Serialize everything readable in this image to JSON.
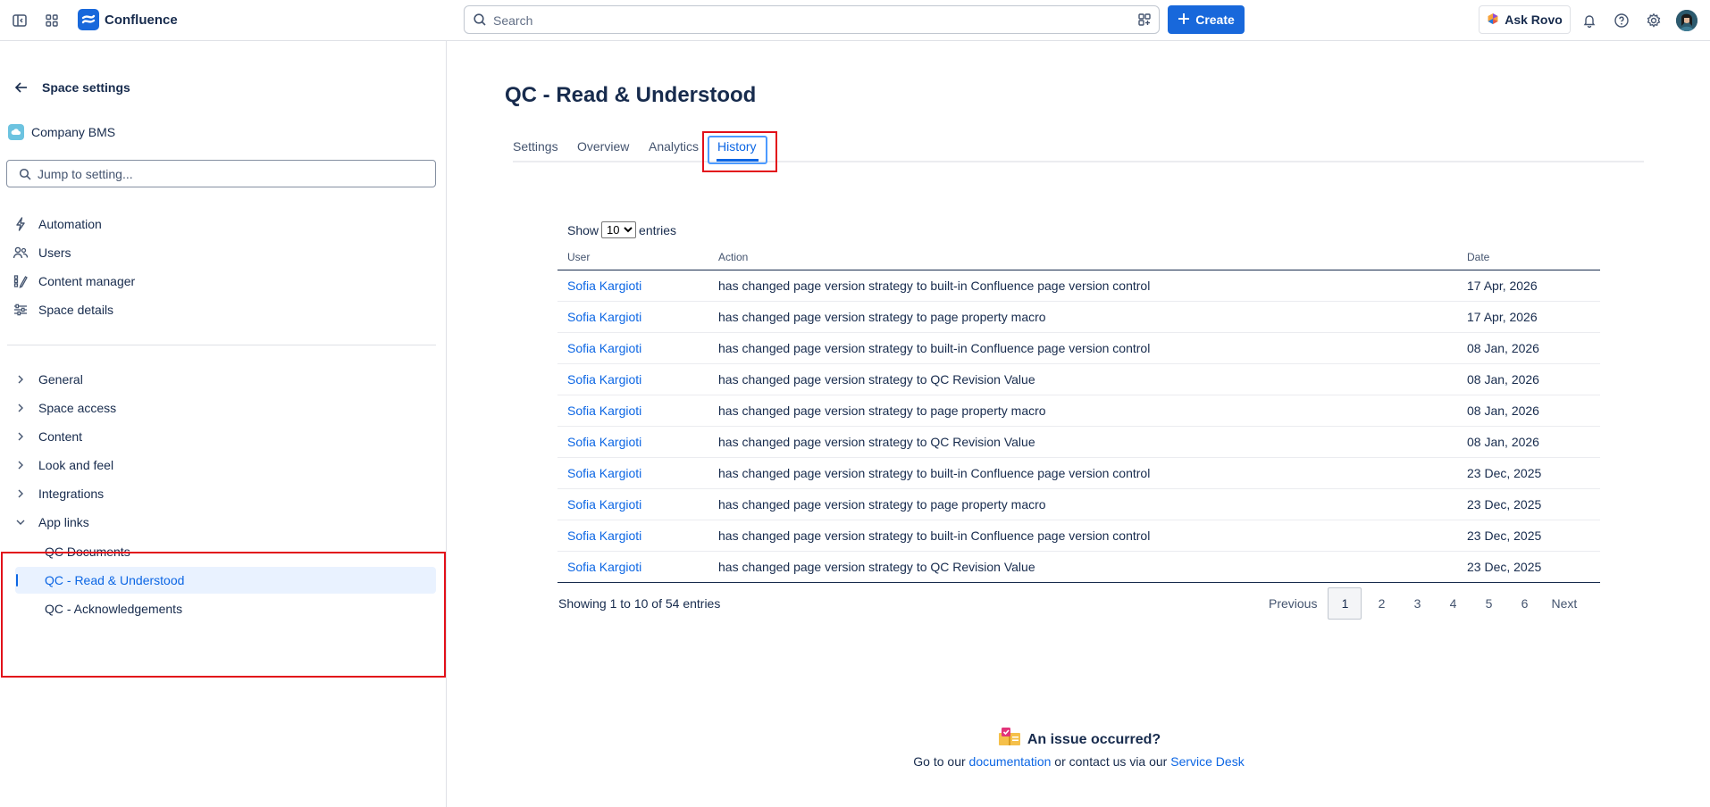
{
  "app": {
    "name": "Confluence"
  },
  "search": {
    "placeholder": "Search"
  },
  "topbar": {
    "create_label": "Create",
    "rovo_label": "Ask Rovo"
  },
  "sidebar": {
    "title": "Space settings",
    "space_name": "Company BMS",
    "jump_placeholder": "Jump to setting...",
    "top_items": [
      {
        "label": "Automation",
        "icon": "lightning-icon"
      },
      {
        "label": "Users",
        "icon": "users-icon"
      },
      {
        "label": "Content manager",
        "icon": "content-manager-icon"
      },
      {
        "label": "Space details",
        "icon": "sliders-icon"
      }
    ],
    "groups": [
      {
        "label": "General"
      },
      {
        "label": "Space access"
      },
      {
        "label": "Content"
      },
      {
        "label": "Look and feel"
      },
      {
        "label": "Integrations"
      },
      {
        "label": "App links"
      }
    ],
    "app_links": [
      {
        "label": "QC Documents"
      },
      {
        "label": "QC - Read & Understood",
        "selected": true
      },
      {
        "label": "QC - Acknowledgements"
      }
    ]
  },
  "main": {
    "title": "QC - Read & Understood",
    "tabs": [
      {
        "label": "Settings"
      },
      {
        "label": "Overview"
      },
      {
        "label": "Analytics"
      },
      {
        "label": "History",
        "active": true
      }
    ],
    "show_label": "Show",
    "entries_label": "entries",
    "page_size": "10",
    "columns": {
      "user": "User",
      "action": "Action",
      "date": "Date"
    },
    "rows": [
      {
        "user": "Sofia Kargioti",
        "action": "has changed page version strategy to built-in Confluence page version control",
        "date": "17 Apr, 2026"
      },
      {
        "user": "Sofia Kargioti",
        "action": "has changed page version strategy to page property macro",
        "date": "17 Apr, 2026"
      },
      {
        "user": "Sofia Kargioti",
        "action": "has changed page version strategy to built-in Confluence page version control",
        "date": "08 Jan, 2026"
      },
      {
        "user": "Sofia Kargioti",
        "action": "has changed page version strategy to QC Revision Value",
        "date": "08 Jan, 2026"
      },
      {
        "user": "Sofia Kargioti",
        "action": "has changed page version strategy to page property macro",
        "date": "08 Jan, 2026"
      },
      {
        "user": "Sofia Kargioti",
        "action": "has changed page version strategy to QC Revision Value",
        "date": "08 Jan, 2026"
      },
      {
        "user": "Sofia Kargioti",
        "action": "has changed page version strategy to built-in Confluence page version control",
        "date": "23 Dec, 2025"
      },
      {
        "user": "Sofia Kargioti",
        "action": "has changed page version strategy to page property macro",
        "date": "23 Dec, 2025"
      },
      {
        "user": "Sofia Kargioti",
        "action": "has changed page version strategy to built-in Confluence page version control",
        "date": "23 Dec, 2025"
      },
      {
        "user": "Sofia Kargioti",
        "action": "has changed page version strategy to QC Revision Value",
        "date": "23 Dec, 2025"
      }
    ],
    "showing_text": "Showing 1 to 10 of 54 entries",
    "pagination": {
      "previous": "Previous",
      "pages": [
        "1",
        "2",
        "3",
        "4",
        "5",
        "6"
      ],
      "current": "1",
      "next": "Next"
    }
  },
  "footer": {
    "title": "An issue occurred?",
    "text_before": "Go to our",
    "doc_link": "documentation",
    "text_middle": "or contact us via our",
    "desk_link": "Service Desk"
  },
  "colors": {
    "accent": "#1868db",
    "link": "#0c66e4",
    "highlight_box": "#e2101a"
  }
}
